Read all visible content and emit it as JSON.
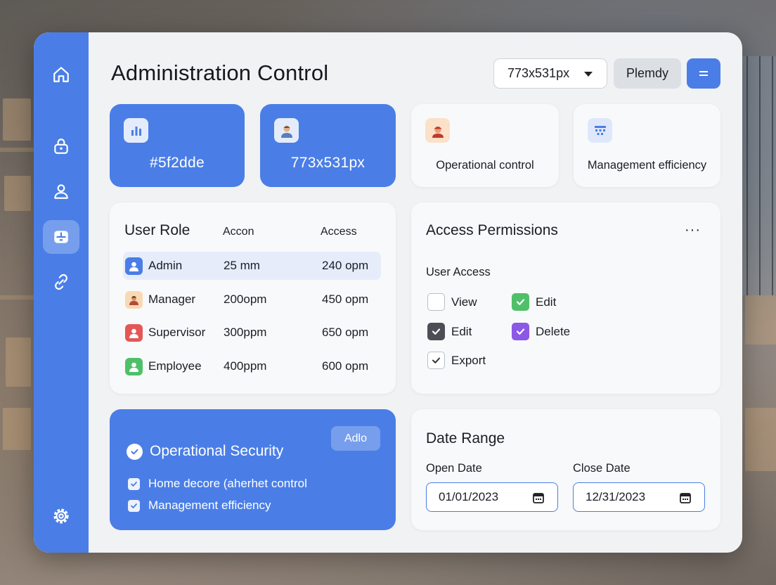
{
  "colors": {
    "accent": "#4a7ee6",
    "panel": "#f1f2f4",
    "card": "#f8f9fa",
    "selected_row": "#e6ecfa"
  },
  "sidebar": {
    "items": [
      {
        "icon": "home-icon"
      },
      {
        "icon": "lock-icon"
      },
      {
        "icon": "user-icon"
      },
      {
        "icon": "dashboard-icon",
        "active": true
      },
      {
        "icon": "link-icon"
      },
      {
        "icon": "gear-icon"
      }
    ]
  },
  "header": {
    "title": "Administration Control",
    "size_select": "773x531px",
    "secondary_button": "Plemdy",
    "menu_icon": "menu-icon"
  },
  "stats": [
    {
      "value": "#5f2dde",
      "icon": "bar-chart-icon"
    },
    {
      "value": "773x531px",
      "icon": "person-icon"
    },
    {
      "label": "Operational control",
      "icon": "worker-icon"
    },
    {
      "label": "Management efficiency",
      "icon": "calendar-grid-icon"
    }
  ],
  "roles_table": {
    "headers": [
      "User Role",
      "Accon",
      "Access"
    ],
    "rows": [
      {
        "role": "Admin",
        "accon": "25 mm",
        "access": "240 opm",
        "color": "#4a7ee6",
        "selected": true
      },
      {
        "role": "Manager",
        "accon": "200opm",
        "access": "450 opm",
        "color": "#f4c79a"
      },
      {
        "role": "Supervisor",
        "accon": "300ppm",
        "access": "650 opm",
        "color": "#e45757"
      },
      {
        "role": "Employee",
        "accon": "400ppm",
        "access": "600 opm",
        "color": "#4fc06a"
      }
    ]
  },
  "permissions": {
    "title": "Access Permissions",
    "more": "···",
    "subtitle": "User Access",
    "items": [
      {
        "label": "View",
        "state": "empty"
      },
      {
        "label": "Edit",
        "state": "checked-green"
      },
      {
        "label": "Edit",
        "state": "checked-dark"
      },
      {
        "label": "Delete",
        "state": "checked-purple"
      },
      {
        "label": "Export",
        "state": "checked-outline"
      }
    ]
  },
  "security": {
    "button": "Adlo",
    "title": "Operational Security",
    "items": [
      "Home decore (aherhet control",
      "Management efficiency"
    ]
  },
  "date_range": {
    "title": "Date Range",
    "open_label": "Open Date",
    "open_value": "01/01/2023",
    "close_label": "Close Date",
    "close_value": "12/31/2023"
  }
}
